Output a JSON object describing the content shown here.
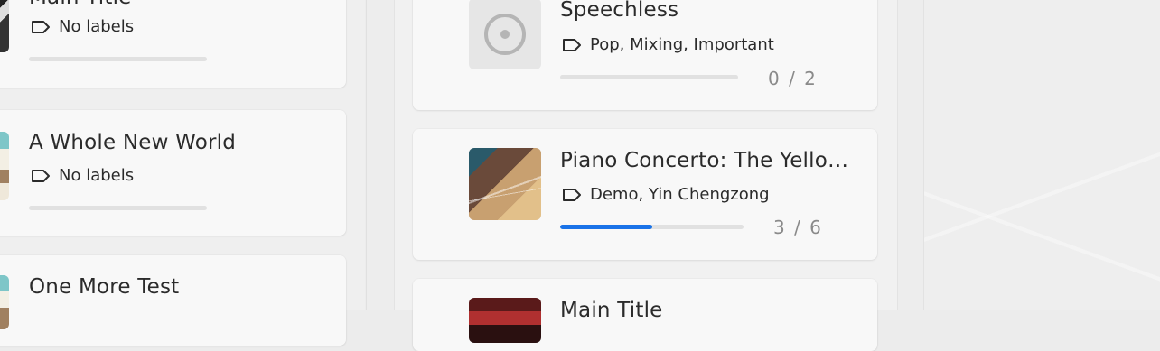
{
  "left_column": {
    "cards": [
      {
        "title": "Main Title",
        "labels": "No labels",
        "progress": 0
      },
      {
        "title": "A Whole New World",
        "labels": "No labels",
        "progress": 0
      },
      {
        "title": "One More Test"
      }
    ]
  },
  "middle_column": {
    "cards": [
      {
        "title": "Speechless",
        "labels": "Pop, Mixing, Important",
        "count": "0 / 2",
        "progress": 0,
        "thumb_icon": "disc-icon"
      },
      {
        "title": "Piano Concerto: The Yellow River",
        "labels": "Demo, Yin Chengzong",
        "count": "3 / 6",
        "progress": 0.5
      },
      {
        "title": "Main Title"
      }
    ]
  },
  "colors": {
    "accent": "#1a73e8",
    "track": "#e1e1e1"
  }
}
